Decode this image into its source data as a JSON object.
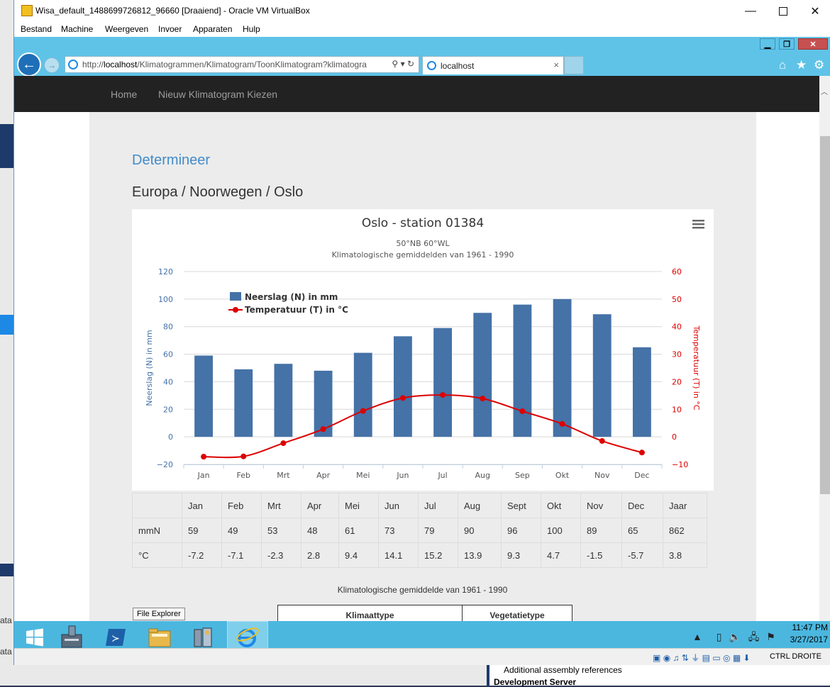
{
  "window": {
    "title": "Wisa_default_1488699726812_96660 [Draaiend] - Oracle VM VirtualBox",
    "menu": [
      "Bestand",
      "Machine",
      "Weergeven",
      "Invoer",
      "Apparaten",
      "Hulp"
    ]
  },
  "browser": {
    "url_prefix": "http://",
    "url_host": "localhost",
    "url_path": "/Klimatogrammen/Klimatogram/ToonKlimatogram?klimatogra",
    "tab_title": "localhost",
    "tab_close": "×"
  },
  "site": {
    "nav": [
      "Home",
      "Nieuw Klimatogram Kiezen"
    ],
    "heading": "Determineer",
    "location": "Europa / Noorwegen / Oslo"
  },
  "chart_data": {
    "type": "bar",
    "title": "Oslo - station 01384",
    "subtitle": [
      "50°NB 60°WL",
      "Klimatologische gemiddelden van 1961 - 1990"
    ],
    "categories": [
      "Jan",
      "Feb",
      "Mrt",
      "Apr",
      "Mei",
      "Jun",
      "Jul",
      "Aug",
      "Sep",
      "Okt",
      "Nov",
      "Dec"
    ],
    "series": [
      {
        "name": "Neerslag (N) in mm",
        "type": "bar",
        "axis": "left",
        "color": "#4572a7",
        "values": [
          59,
          49,
          53,
          48,
          61,
          73,
          79,
          90,
          96,
          100,
          89,
          65
        ]
      },
      {
        "name": "Temperatuur (T) in °C",
        "type": "line",
        "axis": "right",
        "color": "#dd0000",
        "values": [
          -7.2,
          -7.1,
          -2.3,
          2.8,
          9.4,
          14.1,
          15.2,
          13.9,
          9.3,
          4.7,
          -1.5,
          -5.7
        ]
      }
    ],
    "ylabel_left": "Neerslag (N) in mm",
    "ylabel_right": "Temperatuur (T) in °C",
    "ylim_left": [
      -20,
      120
    ],
    "ylim_right": [
      -10,
      60
    ],
    "yticks_left": [
      "120",
      "100",
      "80",
      "60",
      "40",
      "20",
      "0",
      "−20"
    ],
    "yticks_right": [
      "60",
      "50",
      "40",
      "30",
      "20",
      "10",
      "0",
      "−10"
    ],
    "grid": true,
    "legend_position": "top-left",
    "menu_icon": "hamburger-icon"
  },
  "table": {
    "header": [
      "",
      "Jan",
      "Feb",
      "Mrt",
      "Apr",
      "Mei",
      "Jun",
      "Jul",
      "Aug",
      "Sept",
      "Okt",
      "Nov",
      "Dec",
      "Jaar"
    ],
    "rows": [
      [
        "mmN",
        "59",
        "49",
        "53",
        "48",
        "61",
        "73",
        "79",
        "90",
        "96",
        "100",
        "89",
        "65",
        "862"
      ],
      [
        "°C",
        "-7.2",
        "-7.1",
        "-2.3",
        "2.8",
        "9.4",
        "14.1",
        "15.2",
        "13.9",
        "9.3",
        "4.7",
        "-1.5",
        "-5.7",
        "3.8"
      ]
    ]
  },
  "averages_caption": "Klimatologische gemiddelde van 1961 - 1990",
  "lower_table": {
    "headers": [
      "Klimaattype",
      "Vegetatietype"
    ]
  },
  "tooltip": "File Explorer",
  "taskbar": {
    "time": "11:47 PM",
    "date": "3/27/2017"
  },
  "statusbar": {
    "host_key": "CTRL DROITE"
  },
  "host": {
    "line1": "Additional assembly references",
    "line2": "Development Server",
    "left_fragments": [
      "ata",
      "ata"
    ]
  },
  "colors": {
    "ie_chrome": "#5fc3e8",
    "navbar": "#222222",
    "link": "#428bca",
    "bar": "#4572a7",
    "line": "#dd0000"
  }
}
